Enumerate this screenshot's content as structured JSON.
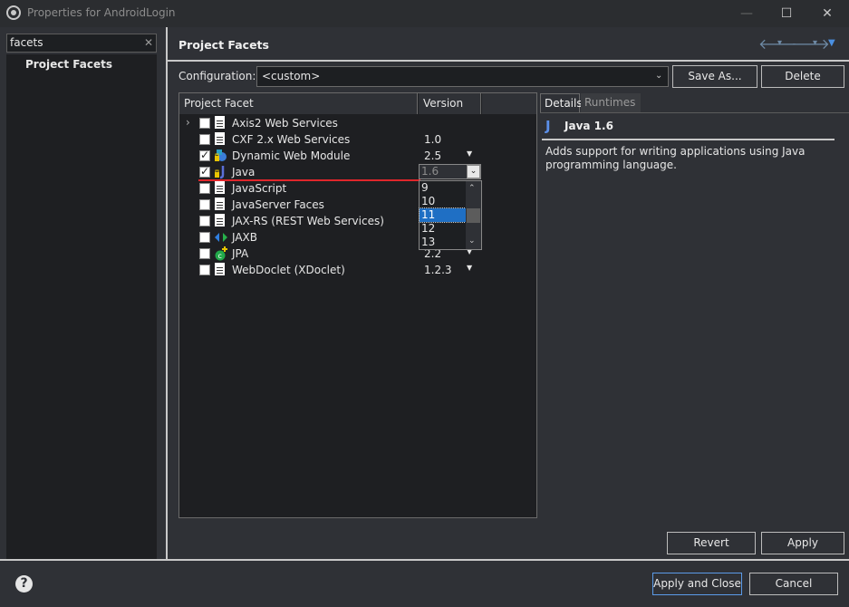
{
  "window": {
    "title": "Properties for AndroidLogin",
    "controls": {
      "minimize": "—",
      "maximize": "☐",
      "close": "✕"
    }
  },
  "sidebar": {
    "filter_value": "facets",
    "filter_clear": "✕",
    "items": [
      {
        "label": "Project Facets"
      }
    ]
  },
  "page": {
    "title": "Project Facets",
    "nav": {
      "back": "🡐",
      "back_menu": "▾",
      "forward": "🡒",
      "forward_menu": "▾",
      "view_menu": "▼"
    }
  },
  "configuration": {
    "label": "Configuration:",
    "value": "<custom>",
    "save_as": "Save As...",
    "delete": "Delete"
  },
  "facet_table": {
    "columns": [
      "Project Facet",
      "Version"
    ],
    "rows": [
      {
        "name": "Axis2 Web Services",
        "version": "",
        "checked": false,
        "expandable": true,
        "icon": "document-icon"
      },
      {
        "name": "CXF 2.x Web Services",
        "version": "1.0",
        "checked": false,
        "icon": "document-icon"
      },
      {
        "name": "Dynamic Web Module",
        "version": "2.5",
        "checked": true,
        "locked": true,
        "icon": "web-module-icon"
      },
      {
        "name": "Java",
        "version": "1.6",
        "checked": true,
        "locked": true,
        "icon": "java-icon",
        "editing": true
      },
      {
        "name": "JavaScript",
        "version": "",
        "checked": false,
        "icon": "document-icon"
      },
      {
        "name": "JavaServer Faces",
        "version": "",
        "checked": false,
        "icon": "document-icon"
      },
      {
        "name": "JAX-RS (REST Web Services)",
        "version": "",
        "checked": false,
        "icon": "document-icon"
      },
      {
        "name": "JAXB",
        "version": "",
        "checked": false,
        "icon": "jaxb-icon"
      },
      {
        "name": "JPA",
        "version": "2.2",
        "checked": false,
        "icon": "jpa-icon"
      },
      {
        "name": "WebDoclet (XDoclet)",
        "version": "1.2.3",
        "checked": false,
        "icon": "document-icon"
      }
    ],
    "version_editor": {
      "value": "1.6",
      "options": [
        "9",
        "10",
        "11",
        "12",
        "13"
      ],
      "selected": "11"
    }
  },
  "details": {
    "tabs": [
      "Details",
      "Runtimes"
    ],
    "active_tab": "Details",
    "icon_glyph": "J",
    "title": "Java 1.6",
    "description": "Adds support for writing applications using Java programming language."
  },
  "page_buttons": {
    "revert": "Revert",
    "apply": "Apply"
  },
  "dialog_buttons": {
    "apply_and_close": "Apply and Close",
    "cancel": "Cancel",
    "help": "?"
  },
  "colors": {
    "accent": "#1f6fc4",
    "background": "#2f3136",
    "error_line": "#e0262b"
  }
}
